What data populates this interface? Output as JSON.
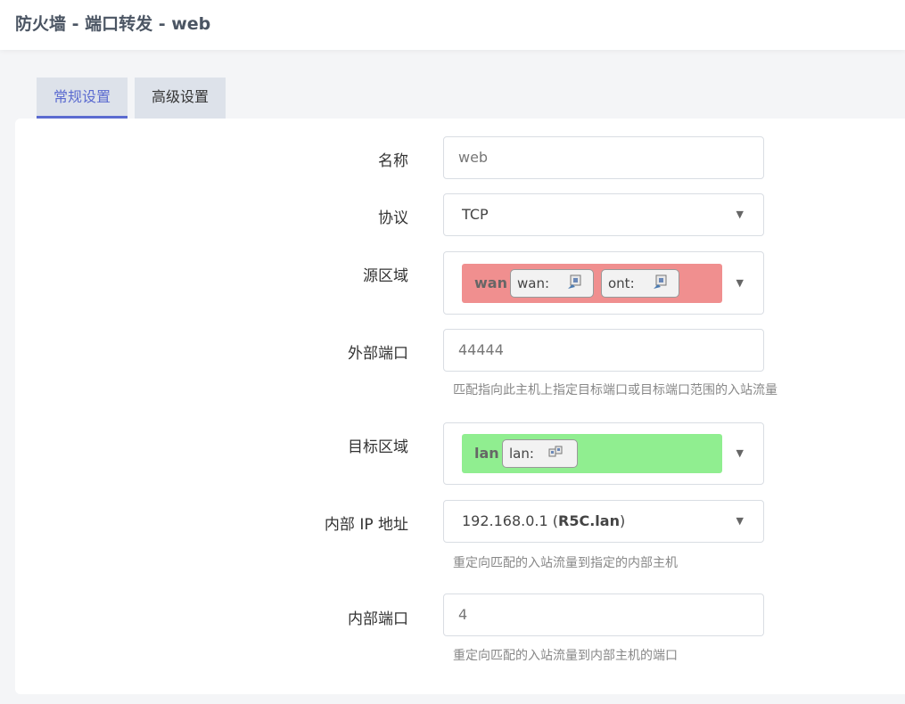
{
  "header": {
    "title": "防火墙 - 端口转发 - web"
  },
  "tabs": [
    {
      "label": "常规设置",
      "active": true
    },
    {
      "label": "高级设置",
      "active": false
    }
  ],
  "form": {
    "name": {
      "label": "名称",
      "value": "web"
    },
    "protocol": {
      "label": "协议",
      "value": "TCP"
    },
    "source_zone": {
      "label": "源区域",
      "zone": "wan",
      "color": "#f08f8f",
      "chips": [
        {
          "label": "wan:",
          "icon": "network-port-icon"
        },
        {
          "label": "ont:",
          "icon": "network-port-icon"
        }
      ]
    },
    "external_port": {
      "label": "外部端口",
      "value": "44444",
      "hint": "匹配指向此主机上指定目标端口或目标端口范围的入站流量"
    },
    "dest_zone": {
      "label": "目标区域",
      "zone": "lan",
      "color": "#90ee90",
      "chips": [
        {
          "label": "lan:",
          "icon": "bridge-icon"
        }
      ]
    },
    "internal_ip": {
      "label": "内部 IP 地址",
      "value_ip": "192.168.0.1 (",
      "value_host": "R5C.lan",
      "value_close": ")",
      "hint": "重定向匹配的入站流量到指定的内部主机"
    },
    "internal_port": {
      "label": "内部端口",
      "value": "4",
      "hint": "重定向匹配的入站流量到内部主机的端口"
    }
  }
}
